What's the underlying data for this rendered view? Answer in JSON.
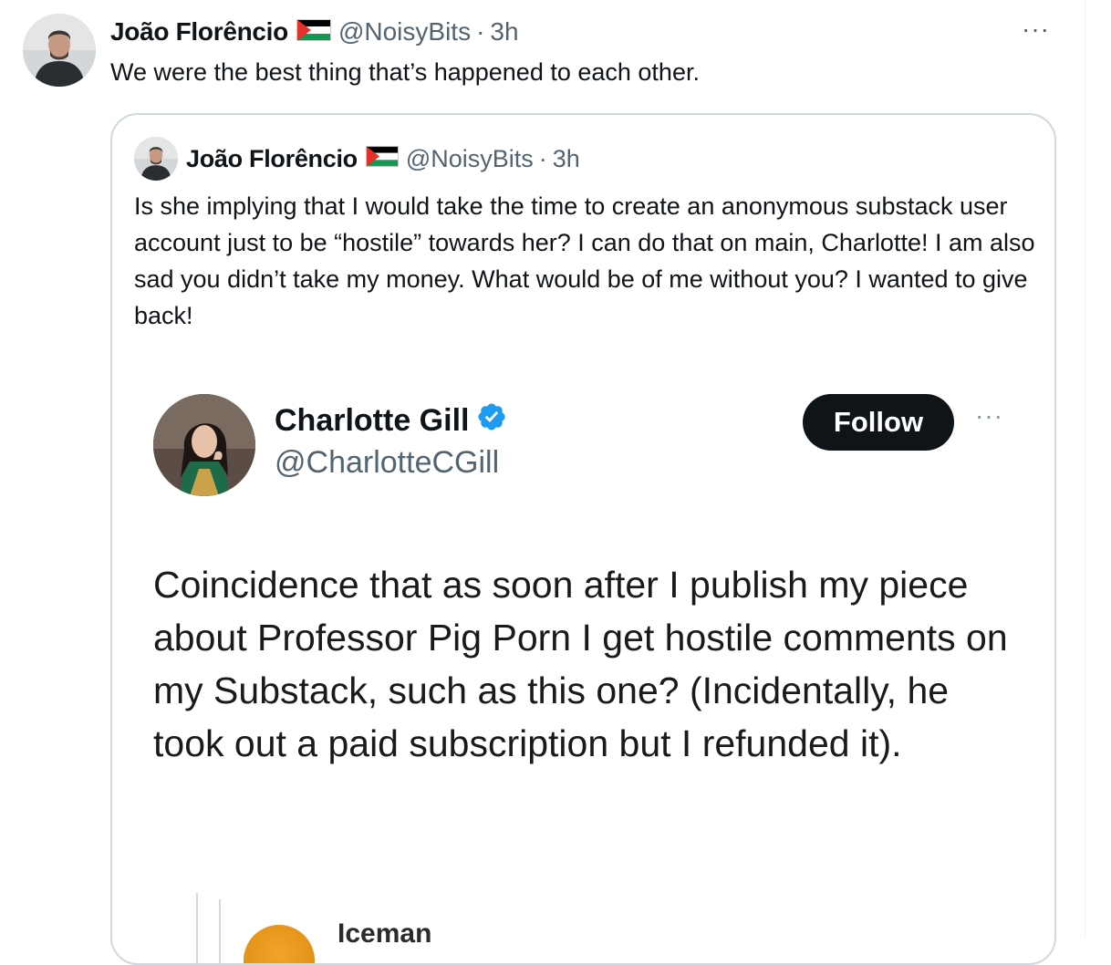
{
  "tweet": {
    "author_name": "João Florêncio",
    "handle": "@NoisyBits",
    "separator": "·",
    "time": "3h",
    "more_icon": "···",
    "text": "We were the best thing that’s happened to each other."
  },
  "quote": {
    "author_name": "João Florêncio",
    "handle": "@NoisyBits",
    "separator": "·",
    "time": "3h",
    "text": "Is she implying that I would take the time to create an anonymous substack user account just to be “hostile” towards her? I can do that on main, Charlotte! I am also sad you didn’t take my money. What would be of me without you? I wanted to give back!",
    "screenshot": {
      "name": "Charlotte Gill",
      "handle": "@CharlotteCGill",
      "follow_label": "Follow",
      "more_icon": "···",
      "text": "Coincidence that as soon after I publish my piece about Professor Pig Porn I get hostile comments on my Substack, such as this one? (Incidentally, he took out a paid subscription but I refunded it).",
      "reply_name": "Iceman"
    }
  },
  "colors": {
    "text": "#0f1419",
    "muted": "#536471",
    "border": "#cfd9de",
    "verified": "#1d9bf0",
    "follow_bg": "#0f1419"
  },
  "icons": [
    "palestine-flag-icon",
    "verified-badge-icon",
    "more-icon"
  ]
}
